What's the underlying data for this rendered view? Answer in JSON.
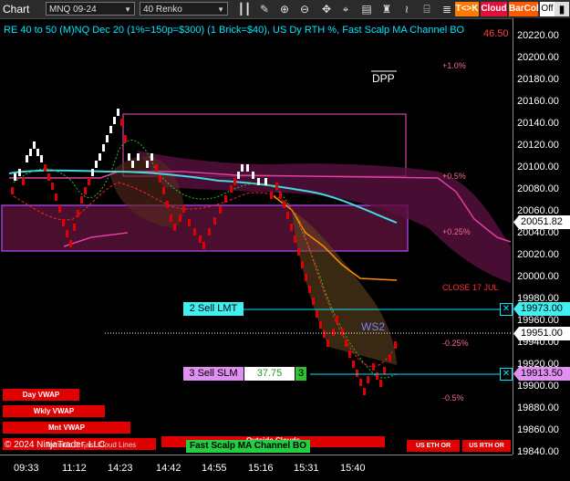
{
  "toolbar": {
    "title": "Chart",
    "instrument": "MNQ 09-24",
    "bar_type": "40 Renko",
    "icons": [
      "bar-style-icon",
      "draw-icon",
      "zoom-in-icon",
      "zoom-out-icon",
      "scroll-icon",
      "crosshair-icon",
      "data-box-icon",
      "strategy-icon",
      "indicators-icon",
      "templates-icon",
      "properties-icon"
    ],
    "tk_label": "T<>K",
    "cloud_label": "Cloud",
    "barcol_label": "BarCol",
    "off_label": "Off"
  },
  "chart": {
    "title": "RE 40 to 50 (M)NQ Dec 20 (1%=150p=$300) (1 Brick=$40), US Dy RTH %, Fast Scalp MA Channel BO",
    "top_right_red": "46.50",
    "dpp_label": "DPP",
    "pct_labels": [
      {
        "text": "+1.0%"
      },
      {
        "text": "+0.5%"
      },
      {
        "text": "+0.25%"
      },
      {
        "text": "CLOSE 17 JUL"
      },
      {
        "text": "-0.25%"
      },
      {
        "text": "-0.5%"
      }
    ],
    "ws2_label": "WS2",
    "sell_lmt_label": "2 Sell LMT",
    "sell_slm_label": "3 Sell SLM",
    "slm_value": "37.75",
    "slm_qty": "3",
    "vwap_labels": [
      "Day VWAP",
      "Wkly VWAP",
      "Mnt VWAP"
    ],
    "copyright": "© 2024 NinjaTrader, LLC",
    "bottom_label_1": "Tornado Jl Fast Cloud Lines",
    "outside_clouds": "Outside Clouds",
    "fast_scalp_label": "Fast Scalp MA Channel BO",
    "us_eth_or": "US ETH OR",
    "us_rth_or": "US RTH OR"
  },
  "yaxis": {
    "ticks": [
      "20220.00",
      "20200.00",
      "20180.00",
      "20160.00",
      "20140.00",
      "20120.00",
      "20100.00",
      "20080.00",
      "20060.00",
      "20040.00",
      "20020.00",
      "20000.00",
      "19980.00",
      "19960.00",
      "19940.00",
      "19920.00",
      "19900.00",
      "19880.00",
      "19860.00",
      "19840.00"
    ],
    "current_price": "20051.82",
    "sell_lmt_price": "19973.00",
    "last_price": "19951.00",
    "sell_slm_price": "19913.50",
    "hidden_price": "19920.00"
  },
  "xaxis": {
    "ticks": [
      "09:33",
      "11:12",
      "14:23",
      "14:42",
      "14:55",
      "15:16",
      "15:31",
      "15:40"
    ]
  },
  "colors": {
    "bull_brick": "#ffffff",
    "bear_brick": "#e00000",
    "cyan": "#00e5ff",
    "violet": "#c070ff",
    "pink": "#ff40c0",
    "orange": "#ff8c00"
  },
  "chart_data": {
    "type": "line",
    "x": [
      "09:33",
      "11:12",
      "14:23",
      "14:42",
      "14:55",
      "15:16",
      "15:31",
      "15:40"
    ],
    "ylim": [
      19830,
      20230
    ],
    "series": [
      {
        "name": "",
        "values": [
          20085,
          20095,
          20095,
          20080,
          20090,
          20075,
          19980,
          19915
        ]
      }
    ],
    "levels": [
      {
        "label": "2 Sell LMT",
        "value": 19973.0
      },
      {
        "label": "3 Sell SLM",
        "value": 19913.5
      },
      {
        "label": "Last",
        "value": 19951.0
      }
    ]
  }
}
